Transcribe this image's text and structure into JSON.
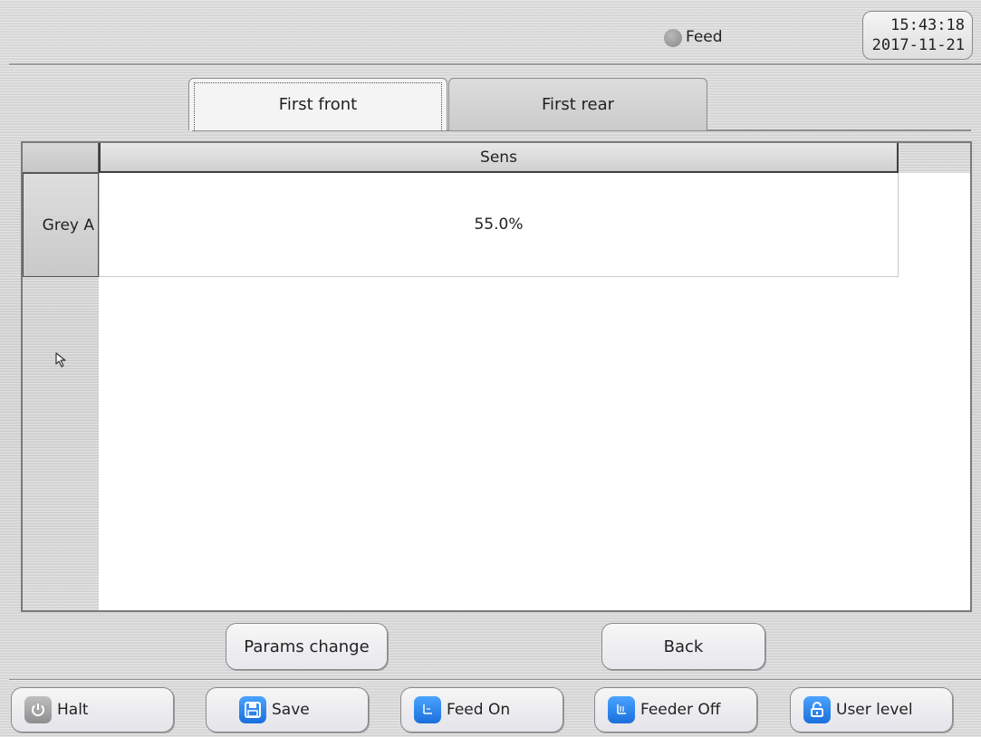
{
  "header": {
    "status_label": "Feed",
    "time": "15:43:18",
    "date": "2017-11-21"
  },
  "tabs": [
    {
      "label": "First front",
      "active": true
    },
    {
      "label": "First rear",
      "active": false
    }
  ],
  "table": {
    "column_header": "Sens",
    "rows": [
      {
        "label": "Grey A",
        "value": "55.0%"
      }
    ]
  },
  "actions": {
    "params_change_label": "Params change",
    "back_label": "Back"
  },
  "toolbar": {
    "items": [
      {
        "label": "Halt",
        "icon": "power-icon"
      },
      {
        "label": "Save",
        "icon": "floppy-disk-icon"
      },
      {
        "label": "Feed On",
        "icon": "feed-on-icon"
      },
      {
        "label": "Feeder Off",
        "icon": "feeder-off-icon"
      },
      {
        "label": "User level",
        "icon": "unlock-icon"
      }
    ]
  },
  "colors": {
    "status_dot": "#9a9a9a",
    "toolbar_icon_blue": "#2a86f0",
    "toolbar_icon_grey": "#a6a6a6"
  }
}
